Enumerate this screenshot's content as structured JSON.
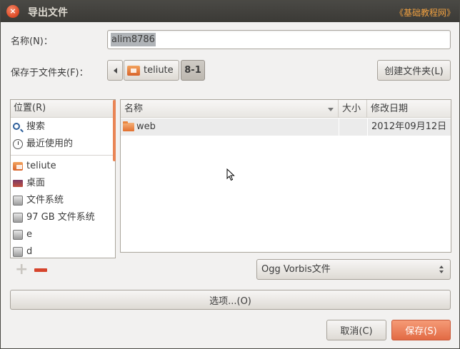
{
  "window": {
    "title": "导出文件",
    "watermark": "《基础教程网》"
  },
  "name_field": {
    "label": "名称(N)：",
    "value": "alim8786"
  },
  "save_in": {
    "label": "保存于文件夹(F)：",
    "path": [
      "teliute",
      "8-1"
    ],
    "create_folder_label": "创建文件夹(L)"
  },
  "places": {
    "header": "位置(R)",
    "items": [
      {
        "label": "搜索",
        "icon": "search-icon"
      },
      {
        "label": "最近使用的",
        "icon": "recent-icon"
      },
      {
        "label": "teliute",
        "icon": "home-folder-icon"
      },
      {
        "label": "桌面",
        "icon": "desktop-icon"
      },
      {
        "label": "文件系统",
        "icon": "drive-icon"
      },
      {
        "label": "97 GB 文件系统",
        "icon": "drive-icon"
      },
      {
        "label": "e",
        "icon": "drive-icon"
      },
      {
        "label": "d",
        "icon": "drive-icon"
      }
    ]
  },
  "file_list": {
    "columns": [
      "名称",
      "大小",
      "修改日期"
    ],
    "rows": [
      {
        "name": "web",
        "size": "",
        "modified": "2012年09月12日"
      }
    ]
  },
  "filter": {
    "selected": "Ogg Vorbis文件"
  },
  "buttons": {
    "options": "选项...(O)",
    "cancel": "取消(C)",
    "save": "保存(S)"
  },
  "colors": {
    "accent": "#e26a44",
    "titlebar": "#3c3b37",
    "scroll_indicator": "#e98556",
    "remove": "#d6442c"
  }
}
